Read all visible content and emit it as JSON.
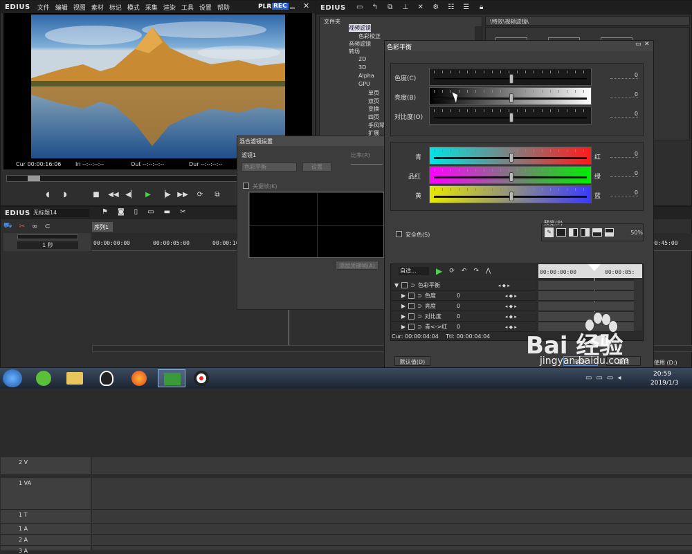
{
  "player": {
    "logo": "EDIUS",
    "menu": [
      "文件",
      "编辑",
      "视图",
      "素材",
      "标记",
      "模式",
      "采集",
      "渲染",
      "工具",
      "设置",
      "帮助"
    ],
    "plr": "PLR",
    "rec": "REC",
    "cur": "Cur 00:00:16:06",
    "in": "In --:--:--:--",
    "out": "Out --:--:--:--",
    "dur": "Dur --:--:--:--"
  },
  "effects": {
    "logo": "EDIUS",
    "folder_header": "文件夹",
    "path": "\\特效\\视频滤镜\\",
    "tree": [
      {
        "label": "视频滤镜",
        "selected": true
      },
      {
        "label": "色彩校正"
      },
      {
        "label": "音频滤镜"
      },
      {
        "label": "转场"
      },
      {
        "label": "2D"
      },
      {
        "label": "3D"
      },
      {
        "label": "Alpha"
      },
      {
        "label": "GPU"
      },
      {
        "label": "单页"
      },
      {
        "label": "双页"
      },
      {
        "label": "变换"
      },
      {
        "label": "四页"
      },
      {
        "label": "手风琴"
      },
      {
        "label": "扩展"
      }
    ]
  },
  "timeline": {
    "logo": "EDIUS",
    "project": "无标题14",
    "sequence_tab": "序列1",
    "scale": "1 秒",
    "ruler": [
      "00:00:00:00",
      "00:00:05:00",
      "00:00:10:00",
      "00:45:00"
    ],
    "tracks": [
      {
        "name": "2 V"
      },
      {
        "name": "1 VA"
      },
      {
        "name": "1 T"
      },
      {
        "name": "1 A"
      },
      {
        "name": "2 A"
      },
      {
        "name": "3 A"
      }
    ]
  },
  "blend_dialog": {
    "title": "混合滤镜设置",
    "filter_label": "滤镜1",
    "filter_value": "色彩平衡",
    "settings_btn": "设置",
    "ratio_label": "比率(R)",
    "keyframe_label": "关键帧(K)",
    "add_keyframe": "添加关键帧(A)"
  },
  "color_balance": {
    "title": "色彩平衡",
    "sliders": [
      {
        "label": "色度(C)",
        "value": "0",
        "thumb": 0.5
      },
      {
        "label": "亮度(B)",
        "value": "0",
        "thumb": 0.5
      },
      {
        "label": "对比度(O)",
        "value": "0",
        "thumb": 0.5
      }
    ],
    "color_sliders": [
      {
        "left": "青",
        "right": "红",
        "value": "0",
        "thumb": 0.5,
        "from": "#00e5e5",
        "to": "#ff1a1a"
      },
      {
        "left": "品红",
        "right": "绿",
        "value": "0",
        "thumb": 0.5,
        "from": "#ff00ff",
        "to": "#00ee00"
      },
      {
        "left": "黄",
        "right": "蓝",
        "value": "0",
        "thumb": 0.5,
        "from": "#e8e800",
        "to": "#3a3aff"
      }
    ],
    "safe_color": "安全色(S)",
    "preview_label": "预览(P)",
    "zoom": "50%",
    "auto": "自适...",
    "kf_ruler": [
      "00:00:00:00",
      "00:00:05:"
    ],
    "kf_rows": [
      {
        "label": "色彩平衡",
        "value": ""
      },
      {
        "label": "色度",
        "value": "0"
      },
      {
        "label": "亮度",
        "value": "0"
      },
      {
        "label": "对比度",
        "value": "0"
      },
      {
        "label": "青<->红",
        "value": "0"
      }
    ],
    "cur": "Cur: 00:00:04:04",
    "ttl": "Ttl: 00:00:04:04",
    "default_btn": "默认值(D)",
    "ok_btn": "确定",
    "cancel_btn": "取消"
  },
  "statusbar": {
    "usage": "使用 (D:)"
  },
  "taskbar": {
    "time": "20:59",
    "date": "2019/1/3"
  },
  "watermark": {
    "text": "Bai 经验",
    "url": "jingyan.baidu.com"
  }
}
